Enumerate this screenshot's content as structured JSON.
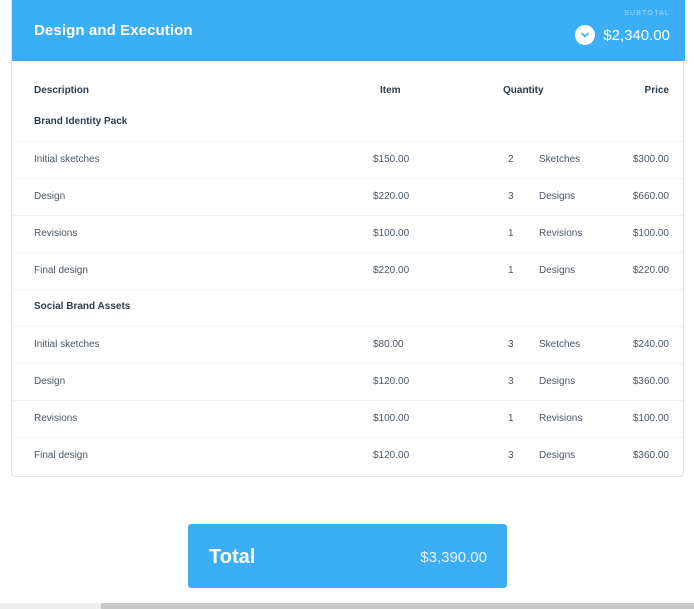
{
  "header": {
    "title": "Design and Execution",
    "subtotal_label": "SUBTOTAL",
    "subtotal_value": "$2,340.00",
    "toggle_icon": "chevron-down-icon",
    "accent_color": "#3baef5"
  },
  "table": {
    "columns": {
      "description": "Description",
      "item": "Item",
      "quantity": "Quantity",
      "price": "Price"
    },
    "groups": [
      {
        "title": "Brand Identity Pack",
        "rows": [
          {
            "description": "Initial sketches",
            "item": "$150.00",
            "qty": "2",
            "unit": "Sketches",
            "price": "$300.00"
          },
          {
            "description": "Design",
            "item": "$220.00",
            "qty": "3",
            "unit": "Designs",
            "price": "$660.00"
          },
          {
            "description": "Revisions",
            "item": "$100.00",
            "qty": "1",
            "unit": "Revisions",
            "price": "$100.00"
          },
          {
            "description": "Final design",
            "item": "$220.00",
            "qty": "1",
            "unit": "Designs",
            "price": "$220.00"
          }
        ]
      },
      {
        "title": "Social Brand Assets",
        "rows": [
          {
            "description": "Initial sketches",
            "item": "$80.00",
            "qty": "3",
            "unit": "Sketches",
            "price": "$240.00"
          },
          {
            "description": "Design",
            "item": "$120.00",
            "qty": "3",
            "unit": "Designs",
            "price": "$360.00"
          },
          {
            "description": "Revisions",
            "item": "$100.00",
            "qty": "1",
            "unit": "Revisions",
            "price": "$100.00"
          },
          {
            "description": "Final design",
            "item": "$120.00",
            "qty": "3",
            "unit": "Designs",
            "price": "$360.00"
          }
        ]
      }
    ]
  },
  "total": {
    "label": "Total",
    "value": "$3,390.00"
  }
}
